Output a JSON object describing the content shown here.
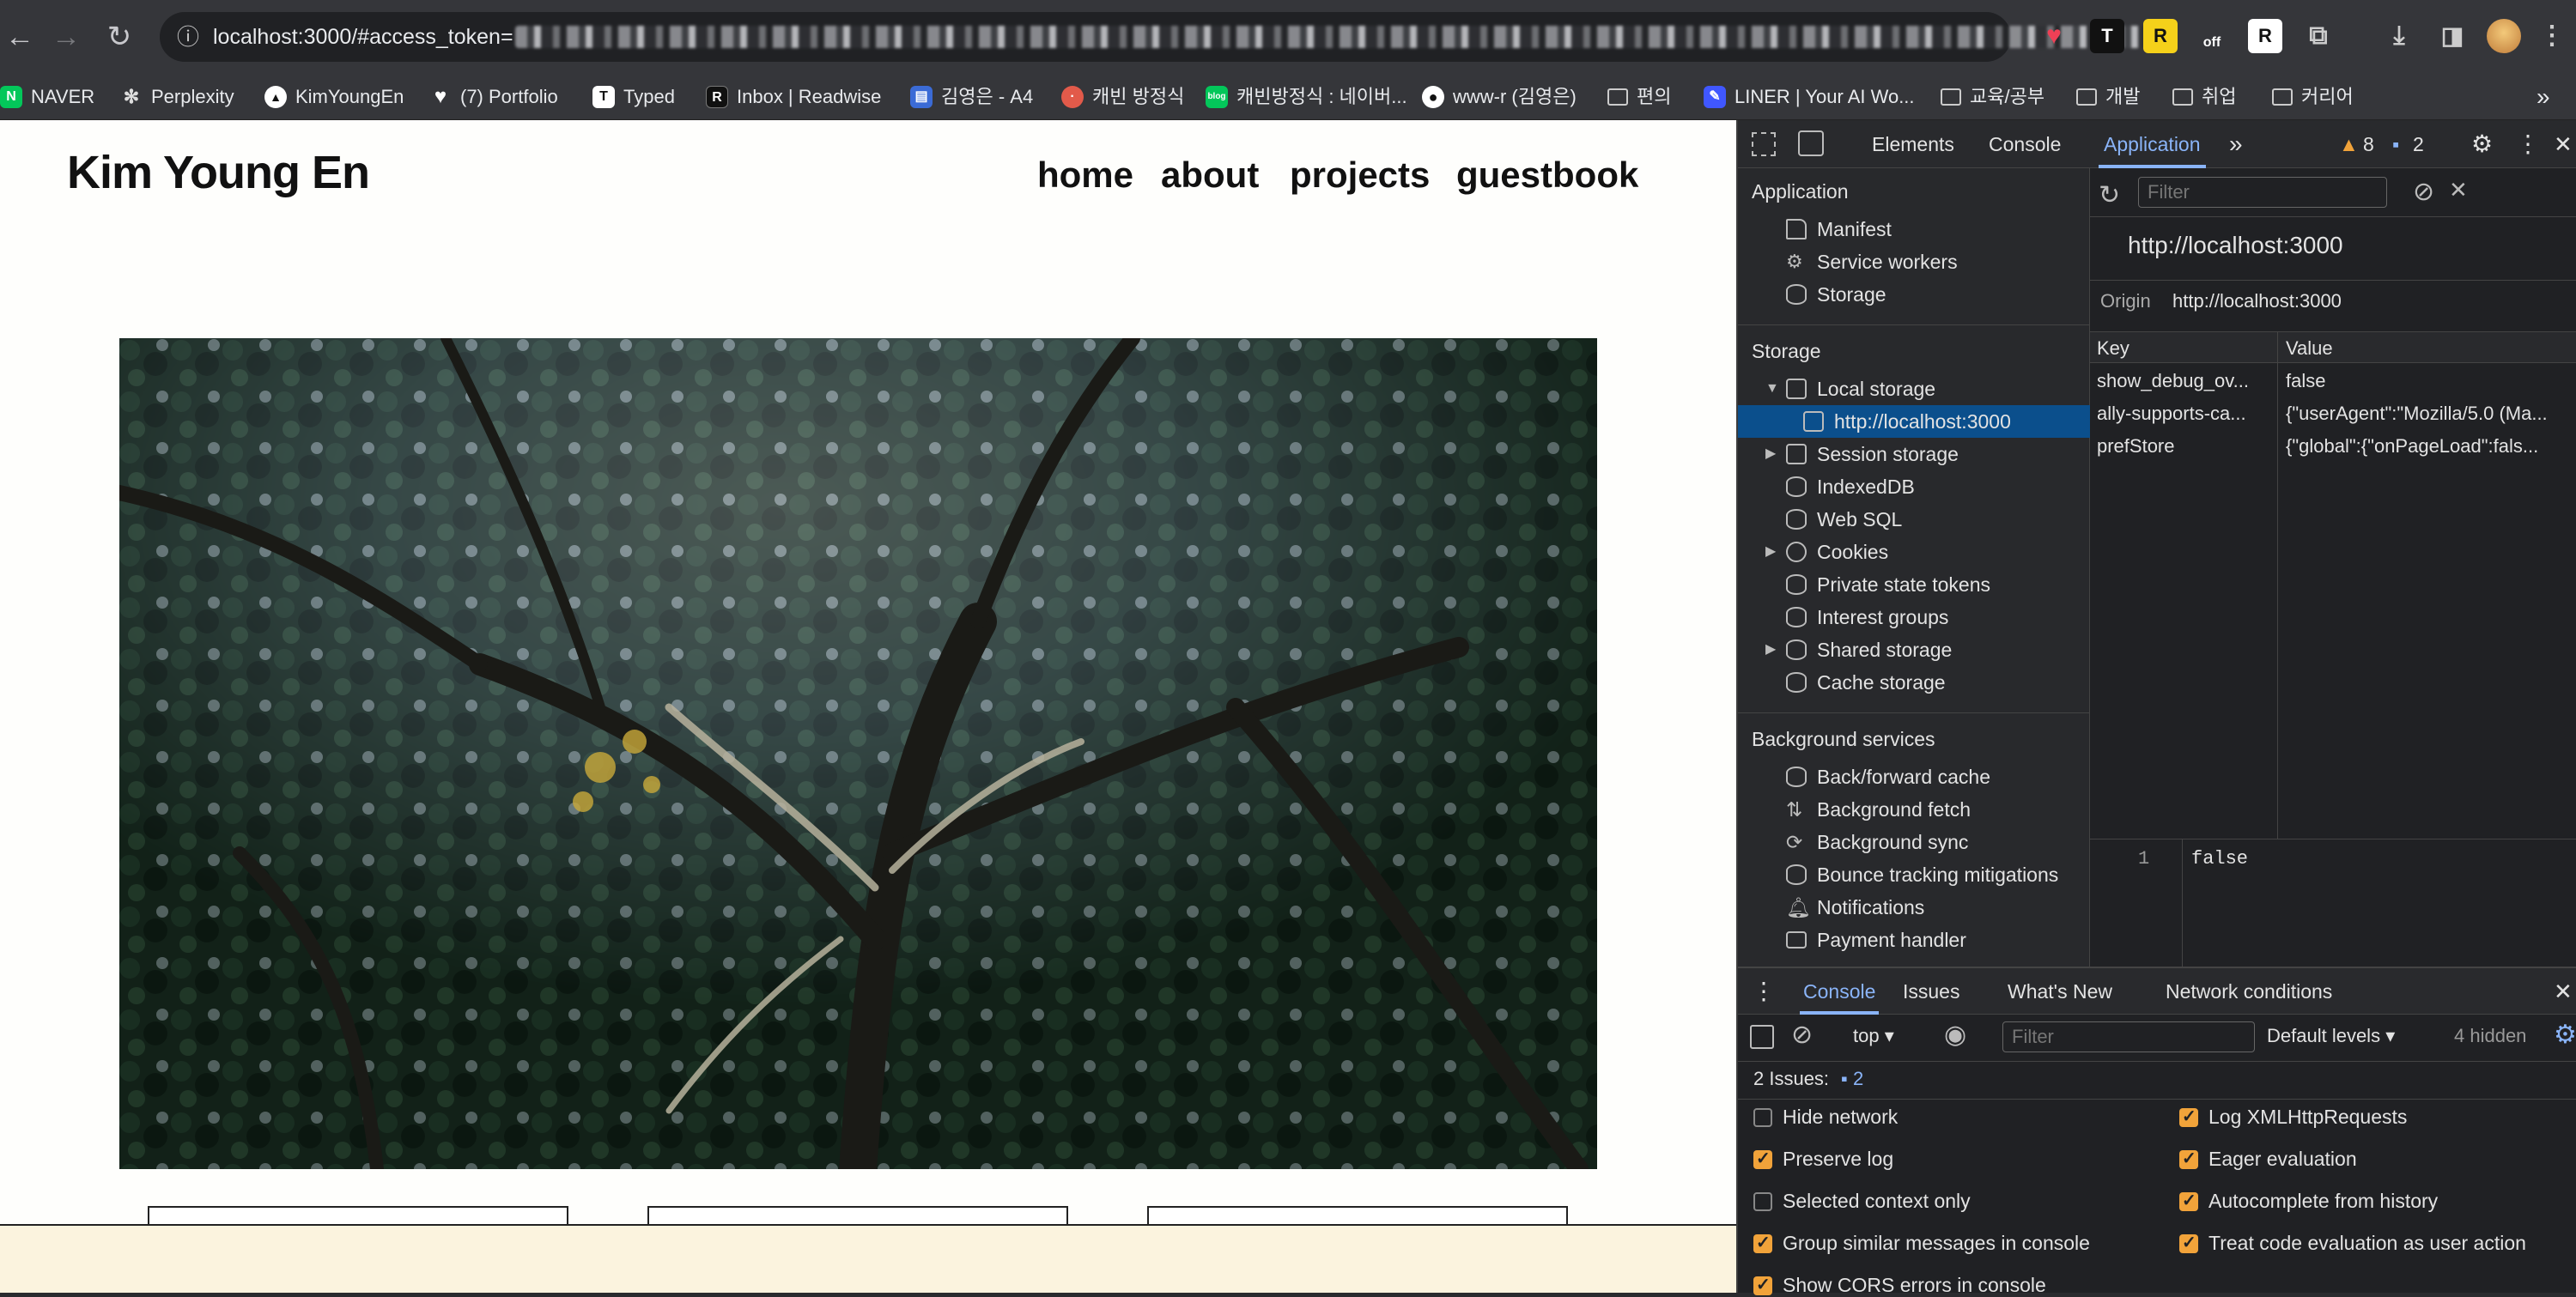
{
  "browser": {
    "url_visible": "localhost:3000/#access_token=",
    "bookmarks": [
      {
        "label": "NAVER",
        "icon": "naver-icon",
        "color": "#03c75a"
      },
      {
        "label": "Perplexity",
        "icon": "perplexity-icon",
        "color": "#555"
      },
      {
        "label": "KimYoungEn",
        "icon": "triangle-icon",
        "color": "#222"
      },
      {
        "label": "(7) Portfolio",
        "icon": "heart-icon",
        "color": "#555"
      },
      {
        "label": "Typed",
        "icon": "typed-icon",
        "color": "#333"
      },
      {
        "label": "Inbox | Readwise",
        "icon": "readwise-icon",
        "color": "#111"
      },
      {
        "label": "김영은 - A4",
        "icon": "a4-icon",
        "color": "#3b6bd6"
      },
      {
        "label": "캐빈 방정식",
        "icon": "cabin-icon",
        "color": "#e25a4a"
      },
      {
        "label": "캐빈방정식 : 네이버...",
        "icon": "naver-blog-icon",
        "color": "#03c75a"
      },
      {
        "label": "www-r (김영은)",
        "icon": "github-icon",
        "color": "#333"
      },
      {
        "label": "편의",
        "icon": "folder-icon",
        "color": "#35363a"
      },
      {
        "label": "LINER | Your AI Wo...",
        "icon": "liner-icon",
        "color": "#4057ff"
      },
      {
        "label": "교육/공부",
        "icon": "folder-icon",
        "color": "#35363a"
      },
      {
        "label": "개발",
        "icon": "folder-icon",
        "color": "#35363a"
      },
      {
        "label": "취업",
        "icon": "folder-icon",
        "color": "#35363a"
      },
      {
        "label": "커리어",
        "icon": "folder-icon",
        "color": "#35363a"
      }
    ],
    "extension_off": "off"
  },
  "page": {
    "brand": "Kim Young En",
    "nav": [
      "home",
      "about",
      "projects",
      "guestbook"
    ]
  },
  "devtools": {
    "tabs": [
      "Elements",
      "Console",
      "Application"
    ],
    "warnings": "8",
    "messages": "2",
    "sidebar": {
      "app_header": "Application",
      "app_items": [
        "Manifest",
        "Service workers",
        "Storage"
      ],
      "storage_header": "Storage",
      "storage_items": [
        "Local storage",
        "http://localhost:3000",
        "Session storage",
        "IndexedDB",
        "Web SQL",
        "Cookies",
        "Private state tokens",
        "Interest groups",
        "Shared storage",
        "Cache storage"
      ],
      "bg_header": "Background services",
      "bg_items": [
        "Back/forward cache",
        "Background fetch",
        "Background sync",
        "Bounce tracking mitigations",
        "Notifications",
        "Payment handler"
      ]
    },
    "main": {
      "filter_placeholder": "Filter",
      "origin_title": "http://localhost:3000",
      "origin_label": "Origin",
      "origin_value": "http://localhost:3000",
      "col_key": "Key",
      "col_value": "Value",
      "rows": [
        {
          "key": "show_debug_ov...",
          "value": "false"
        },
        {
          "key": "ally-supports-ca...",
          "value": "{\"userAgent\":\"Mozilla/5.0 (Ma..."
        },
        {
          "key": "prefStore",
          "value": "{\"global\":{\"onPageLoad\":fals..."
        }
      ],
      "preview_line": "1",
      "preview_value": "false"
    },
    "console": {
      "tabs": [
        "Console",
        "Issues",
        "What's New",
        "Network conditions"
      ],
      "context": "top",
      "filter_placeholder": "Filter",
      "levels": "Default levels",
      "hidden": "4 hidden",
      "issues_label": "2 Issues:",
      "issues_count": "2",
      "left_options": [
        {
          "label": "Hide network",
          "checked": false
        },
        {
          "label": "Preserve log",
          "checked": true
        },
        {
          "label": "Selected context only",
          "checked": false
        },
        {
          "label": "Group similar messages in console",
          "checked": true
        },
        {
          "label": "Show CORS errors in console",
          "checked": true
        }
      ],
      "right_options": [
        {
          "label": "Log XMLHttpRequests",
          "checked": true
        },
        {
          "label": "Eager evaluation",
          "checked": true
        },
        {
          "label": "Autocomplete from history",
          "checked": true
        },
        {
          "label": "Treat code evaluation as user action",
          "checked": true
        }
      ]
    }
  }
}
